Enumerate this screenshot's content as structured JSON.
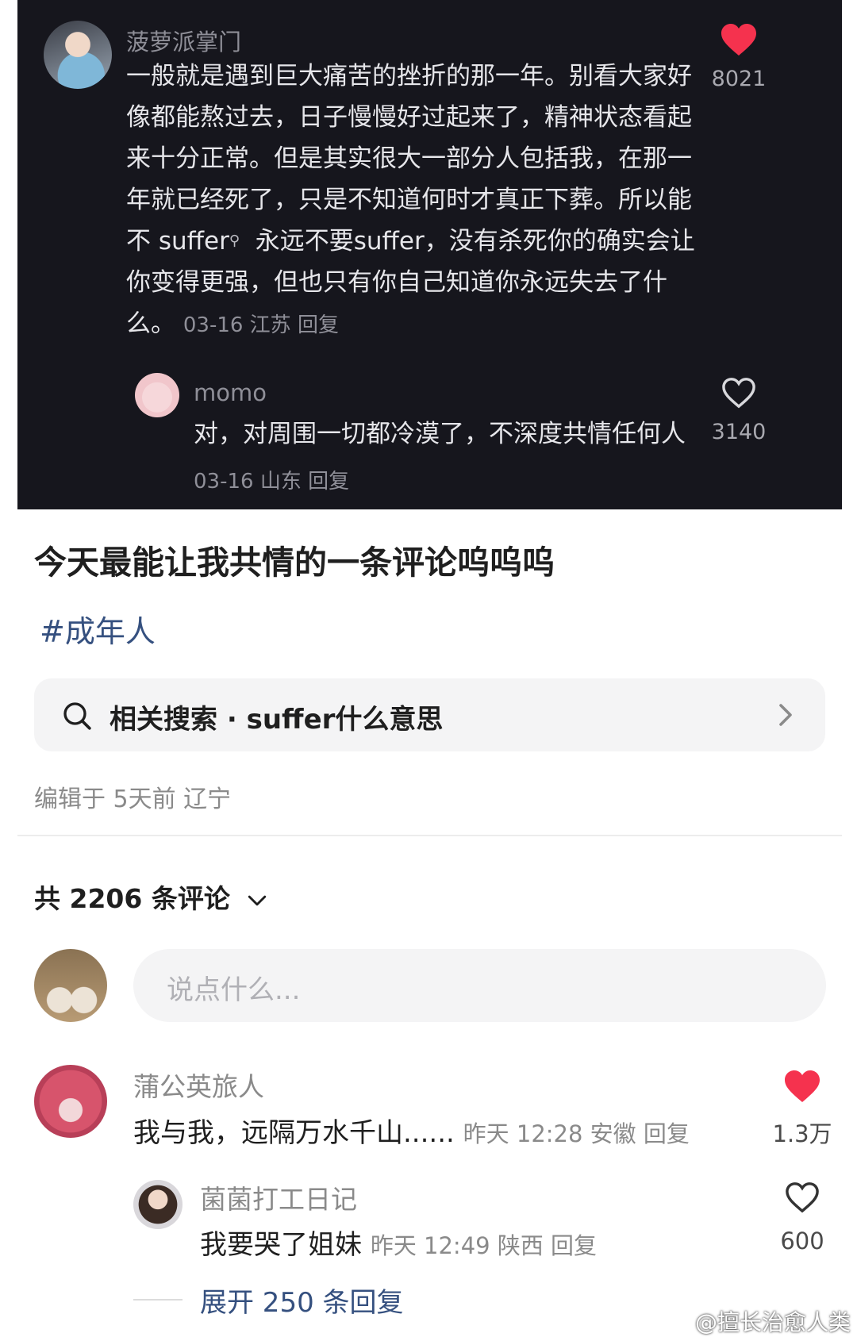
{
  "dark_screenshot": {
    "comment1": {
      "username": "菠萝派掌门",
      "lines": [
        "一般就是遇到巨大痛苦的挫折的那一年。别看大家好",
        "像都能熬过去，日子慢慢好过起来了，精神状态看起",
        "来十分正常。但是其实很大一部分人包括我，在那一",
        "年就已经死了，只是不知道何时才真正下葬。所以能",
        "不 suffer",
        "永远不要suffer，没有杀死你的确实会让",
        "你变得更强，但也只有你自己知道你永远失去了什",
        "么。"
      ],
      "meta": "03-16 江苏 回复",
      "likes": "8021",
      "liked": true
    },
    "reply1": {
      "username": "momo",
      "text": "对，对周围一切都冷漠了，不深度共情任何人",
      "meta": "03-16 山东 回复",
      "likes": "3140",
      "liked": false
    }
  },
  "post": {
    "title": "今天最能让我共情的一条评论呜呜呜",
    "hashtag": "#成年人",
    "related_search": "相关搜索 · suffer什么意思",
    "edited": "编辑于 5天前 辽宁"
  },
  "comments_header": {
    "count_label": "共 2206 条评论"
  },
  "comment_input": {
    "placeholder": "说点什么..."
  },
  "comments": [
    {
      "username": "蒲公英旅人",
      "text": "我与我，远隔万水千山......",
      "meta": "昨天 12:28 安徽 回复",
      "likes": "1.3万",
      "liked": true
    },
    {
      "username": "菌菌打工日记",
      "text": "我要哭了姐妹",
      "meta": "昨天 12:49 陕西 回复",
      "likes": "600",
      "liked": false
    }
  ],
  "expand_replies": "展开 250 条回复",
  "watermark": "@擅长治愈人类",
  "colors": {
    "accent_link": "#35507f",
    "heart_red": "#f5324e",
    "dark_bg": "#16161d"
  }
}
